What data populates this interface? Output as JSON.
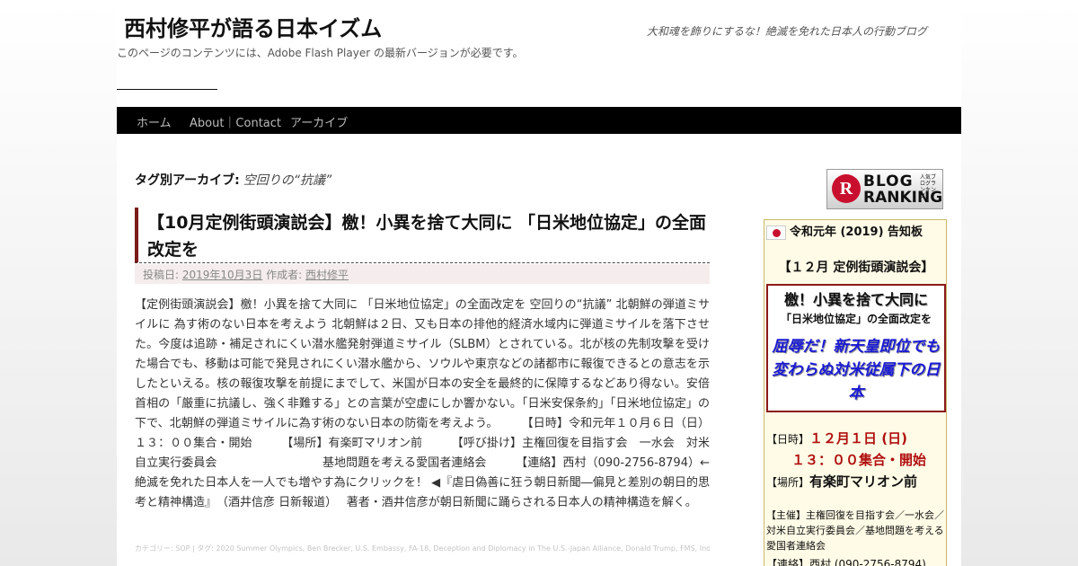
{
  "header": {
    "site_title": "西村修平が語る日本イズム",
    "description": "大和魂を飾りにするな！絶滅を免れた日本人の行動ブログ",
    "flash_note": "このページのコンテンツには、Adobe Flash Player の最新バージョンが必要です。"
  },
  "nav": {
    "items": [
      "ホーム",
      "About｜Contact",
      "アーカイブ"
    ]
  },
  "archive": {
    "label": "タグ別アーカイブ:",
    "tag": "空回りの“抗議”"
  },
  "post": {
    "title": "【10月定例街頭演説会】檄！小異を捨て大同に 「日米地位協定」の全面改定を",
    "meta_posted_label": "投稿日:",
    "meta_date": "2019年10月3日",
    "meta_author_label": "作成者:",
    "meta_author": "西村修平",
    "body": "【定例街頭演説会】檄！小異を捨て大同に 「日米地位協定」の全面改定を 空回りの“抗議” 北朝鮮の弾道ミサイルに 為す術のない日本を考えよう 北朝鮮は２日、又も日本の排他的経済水域内に弾道ミサイルを落下させた。今度は追跡・補足されにくい潜水艦発射弾道ミサイル（SLBM）とされている。北が核の先制攻撃を受けた場合でも、移動は可能で発見されにくい潜水艦から、ソウルや東京などの諸都市に報復できるとの意志を示したといえる。核の報復攻撃を前提にまでして、米国が日本の安全を最終的に保障するなどあり得ない。安倍首相の「厳重に抗議し、強く非難する」との言葉が空虚にしか響かない。「日米安保条約」「日米地位協定」の下で、北朝鮮の弾道ミサイルに為す術のない日本の防衛を考えよう。　　　【日時】令和元年１０月６日（日）１３：００集合・開始　　　【場所】有楽町マリオン前　　　【呼び掛け】主権回復を目指す会　一水会　対米自立実行委員会　　　　　　　　　基地問題を考える愛国者連絡会　　　【連絡】西村（090-2756-8794）←絶滅を免れた日本人を一人でも増やす為にクリックを！ ◀『虐日偽善に狂う朝日新聞―偏見と差別の朝日的思考と精神構造』　（酒井信彦 日新報道）　 著者・酒井信彦が朝日新聞に踊らされる日本人の精神構造を解く。",
    "footer": "カテゴリー: SOP | タグ: 2020 Summer Olympics, Ben Brecker, U.S. Embassy, FA-18, Deception and Diplomacy in The U.S.-Japan Alliance, Donald Trump, FMS, Indo-Pacific, SOFA, Status of Forces Agreement, Naval Forces Japan, The Thinker"
  },
  "sidebar": {
    "ranking": {
      "letter": "R",
      "line1": "BLOG",
      "line2": "RANKING",
      "small": "人気ブログランキング"
    },
    "notice": {
      "title": "令和元年 (2019) 告知板",
      "heading": "【１２月 定例街頭演説会】",
      "red_line1": "檄！小異を捨て大同に",
      "red_line2": "「日米地位協定」の全面改定を",
      "red_line3": "屈辱だ！新天皇即位でも変わらぬ対米従属下の日本",
      "date_label": "【日時】",
      "date_value": "１２月１日 (日)",
      "time_value": "１３：００集合・開始",
      "place_label": "【場所】",
      "place_value": "有楽町マリオン前",
      "sponsor": "【主催】主権回復を目指す会／一水会／対米自立実行委員会／基地問題を考える愛国者連絡会",
      "contact": "【連絡】西村 (090-2756-8794)"
    }
  },
  "colors": {
    "nav_bg": "#000000",
    "accent_red": "#b01010",
    "accent_blue": "#1a1ad6",
    "notice_bg": "#fffbe6"
  }
}
